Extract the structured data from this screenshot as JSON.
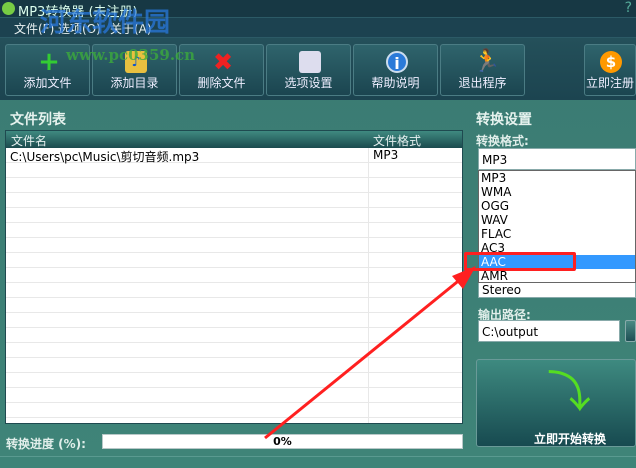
{
  "window": {
    "title": "MP3转换器 (未注册)",
    "help": "?"
  },
  "watermark": {
    "name": "河东软件园",
    "url": "www.pc0359.cn"
  },
  "menu": [
    "文件(F)",
    "选项(O)",
    "关于(A)"
  ],
  "toolbar": [
    {
      "label": "添加文件",
      "icon": "plus-icon"
    },
    {
      "label": "添加目录",
      "icon": "folder-music-icon"
    },
    {
      "label": "删除文件",
      "icon": "delete-x-icon"
    },
    {
      "label": "选项设置",
      "icon": "cube-icon"
    },
    {
      "label": "帮助说明",
      "icon": "info-icon"
    },
    {
      "label": "退出程序",
      "icon": "running-man-icon"
    },
    {
      "label": "立即注册",
      "icon": "dollar-coin-icon"
    }
  ],
  "file_list": {
    "title": "文件列表",
    "columns": [
      "文件名",
      "文件格式"
    ],
    "rows": [
      {
        "name": "C:\\Users\\pc\\Music\\剪切音频.mp3",
        "format": "MP3"
      }
    ]
  },
  "progress": {
    "label": "转换进度 (%):",
    "value": "0%",
    "percent": 0
  },
  "settings": {
    "title": "转换设置",
    "format_label": "转换格式:",
    "format_value": "MP3",
    "format_options": [
      "MP3",
      "WMA",
      "OGG",
      "WAV",
      "FLAC",
      "AC3",
      "AAC",
      "AMR"
    ],
    "highlighted": "AAC",
    "channel_value": "Stereo",
    "output_label": "输出路径:",
    "output_value": "C:\\output",
    "start_label": "立即开始转换"
  },
  "colors": {
    "highlight": "#3399ff",
    "annotation": "#ff2020"
  }
}
